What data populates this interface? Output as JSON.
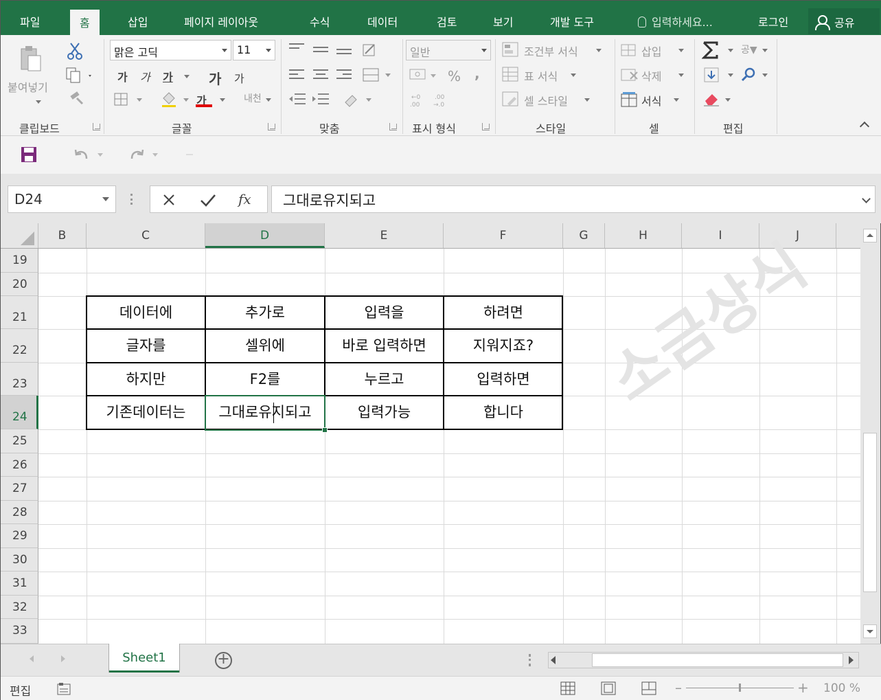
{
  "tabs": [
    "파일",
    "홈",
    "삽입",
    "페이지 레이아웃",
    "수식",
    "데이터",
    "검토",
    "보기",
    "개발 도구"
  ],
  "tell_me": "입력하세요...",
  "login": "로그인",
  "share": "공유",
  "ribbon": {
    "clipboard": {
      "label": "클립보드",
      "paste": "붙여넣기"
    },
    "font": {
      "label": "글꼴",
      "font_name": "맑은 고딕",
      "font_size": "11",
      "bold": "가",
      "italic": "가",
      "underline": "가",
      "grow": "가",
      "shrink": "가",
      "font_color": "가",
      "phonetic": "내천"
    },
    "alignment": {
      "label": "맞춤"
    },
    "number": {
      "label": "표시 형식",
      "format": "일반",
      "percent": "%",
      "comma": ","
    },
    "styles": {
      "label": "스타일",
      "conditional": "조건부 서식",
      "table": "표 서식",
      "cell": "셀 스타일"
    },
    "cells": {
      "label": "셀",
      "insert": "삽입",
      "delete": "삭제",
      "format": "서식"
    },
    "editing": {
      "label": "편집",
      "sort": "공▼"
    }
  },
  "name_box": "D24",
  "formula": "그대로유지되고",
  "fx": "fx",
  "columns": [
    "B",
    "C",
    "D",
    "E",
    "F",
    "G",
    "H",
    "I",
    "J"
  ],
  "selected_column": "D",
  "rows": [
    "19",
    "20",
    "21",
    "22",
    "23",
    "24",
    "25",
    "26",
    "27",
    "28",
    "29",
    "30",
    "31",
    "32",
    "33"
  ],
  "selected_row": "24",
  "table": [
    [
      "데이터에",
      "추가로",
      "입력을",
      "하려면"
    ],
    [
      "글자를",
      "셀위에",
      "바로 입력하면",
      "지워지죠?"
    ],
    [
      "하지만",
      "F2를",
      "누르고",
      "입력하면"
    ],
    [
      "기존데이터는",
      "그대로유지되고",
      "입력가능",
      "합니다"
    ]
  ],
  "watermark": "소금상식",
  "sheet_tab": "Sheet1",
  "add_sheet": "+",
  "status": {
    "mode": "편집",
    "zoom": "100 %"
  },
  "colors": {
    "accent": "#217346",
    "grid_line": "#dadada",
    "header_bg": "#e6e6e6"
  }
}
